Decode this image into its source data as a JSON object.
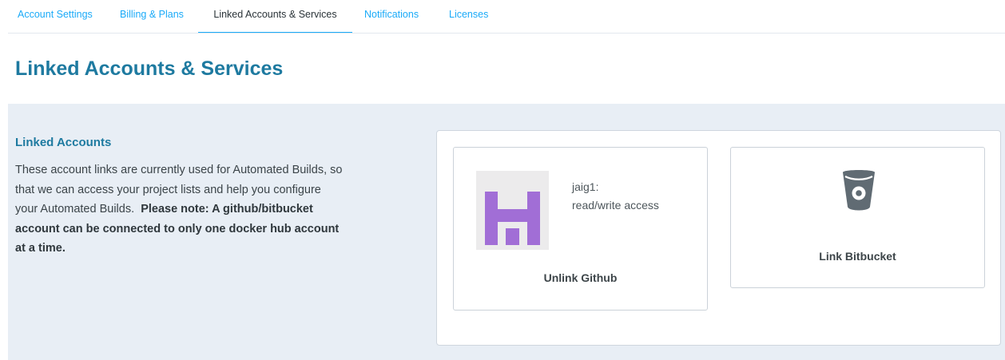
{
  "tabs": [
    {
      "label": "Account Settings",
      "active": false
    },
    {
      "label": "Billing & Plans",
      "active": false
    },
    {
      "label": "Linked Accounts & Services",
      "active": true
    },
    {
      "label": "Notifications",
      "active": false
    },
    {
      "label": "Licenses",
      "active": false
    }
  ],
  "page": {
    "title": "Linked Accounts & Services"
  },
  "linked_accounts": {
    "title": "Linked Accounts",
    "description": "These account links are currently used for Automated Builds, so that we can access your project lists and help you configure your Automated Builds.",
    "note": "Please note: A github/bitbucket account can be connected to only one docker hub account at a time."
  },
  "github": {
    "username": "jaig1:",
    "access": "read/write access",
    "action_label": "Unlink Github",
    "avatar_color": "#a16ed6"
  },
  "bitbucket": {
    "action_label": "Link Bitbucket",
    "icon": "bitbucket-icon",
    "icon_color": "#606b73"
  },
  "colors": {
    "accent": "#1aaaf8",
    "title": "#1e7aa0",
    "section_bg": "#e8eef5"
  }
}
